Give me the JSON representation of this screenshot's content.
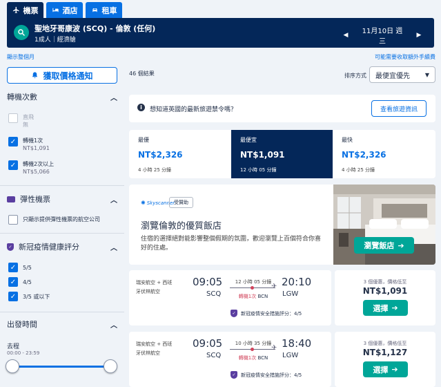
{
  "tabs": [
    {
      "label": "機票",
      "icon": "airplane-icon"
    },
    {
      "label": "酒店",
      "icon": "bed-icon"
    },
    {
      "label": "租車",
      "icon": "car-icon"
    }
  ],
  "header": {
    "route": "聖地牙哥康波 (SCQ) - 倫敦 (任何)",
    "passengers": "1成人｜經濟艙",
    "date": "11月10日 週三"
  },
  "top_links": {
    "show_total": "顯示整個月",
    "baggage_fees": "可能需要收取額外手續費"
  },
  "price_alert": {
    "label": "獲取價格通知"
  },
  "filters": {
    "stops": {
      "title": "轉機次數",
      "options": [
        {
          "label": "直飛",
          "sub": "無",
          "checked": false
        },
        {
          "label": "轉機1次",
          "sub": "NT$1,091",
          "checked": true
        },
        {
          "label": "轉機2次以上",
          "sub": "NT$5,066",
          "checked": true
        }
      ]
    },
    "flexible": {
      "title": "彈性機票",
      "option": "只顯示提供彈性機票的航空公司"
    },
    "covid": {
      "title": "新冠疫情健康評分",
      "options": [
        {
          "label": "5/5",
          "checked": true
        },
        {
          "label": "4/5",
          "checked": true
        },
        {
          "label": "3/5 或以下",
          "checked": true
        }
      ]
    },
    "departure": {
      "title": "出發時間",
      "leg": "去程",
      "range": "00:00 - 23:59"
    }
  },
  "results": {
    "count": "46 個結果",
    "sort_label": "排序方式",
    "sort_value": "最便宜優先"
  },
  "travel_banner": {
    "text": "想知道英國的最新旅遊禁令嗎？",
    "button": "查看旅遊資訊"
  },
  "sort_tabs": [
    {
      "title": "最優",
      "price": "NT$2,326",
      "duration": "4 小時 25 分鐘",
      "selected": false
    },
    {
      "title": "最便宜",
      "price": "NT$1,091",
      "duration": "12 小時 05 分鐘",
      "selected": true
    },
    {
      "title": "最快",
      "price": "NT$2,326",
      "duration": "4 小時 25 分鐘",
      "selected": false
    }
  ],
  "hotel_ad": {
    "brand": "Skyscanner",
    "sponsored": "受贊助",
    "title": "瀏覽倫敦的優質飯店",
    "body": "住宿的選擇絕對能影響整個假期的氛圍，歡迎瀏覽上百個符合你喜好的住處。",
    "button": "瀏覽飯店"
  },
  "flights": [
    {
      "airline_line1": "瑞安航空 + 西班",
      "airline_line2": "牙伏林航空",
      "depart_time": "09:05",
      "depart_code": "SCQ",
      "duration": "12 小時 05 分鐘",
      "stops": "轉機1次",
      "via": "BCN",
      "arrive_time": "20:10",
      "arrive_code": "LGW",
      "covid": "新冠疫情安全措施評分：4/5",
      "deals": "3 個優惠，價格低至",
      "price": "NT$1,091",
      "select": "選擇"
    },
    {
      "airline_line1": "瑞安航空 + 西班",
      "airline_line2": "牙伏林航空",
      "depart_time": "09:05",
      "depart_code": "SCQ",
      "duration": "10 小時 35 分鐘",
      "stops": "轉機1次",
      "via": "BCN",
      "arrive_time": "18:40",
      "arrive_code": "LGW",
      "covid": "新冠疫情安全措施評分：4/5",
      "deals": "3 個優惠，價格低至",
      "price": "NT$1,127",
      "select": "選擇"
    }
  ],
  "colors": {
    "navy": "#042759",
    "blue": "#0770e3",
    "teal": "#00a698",
    "red": "#d1435b"
  }
}
